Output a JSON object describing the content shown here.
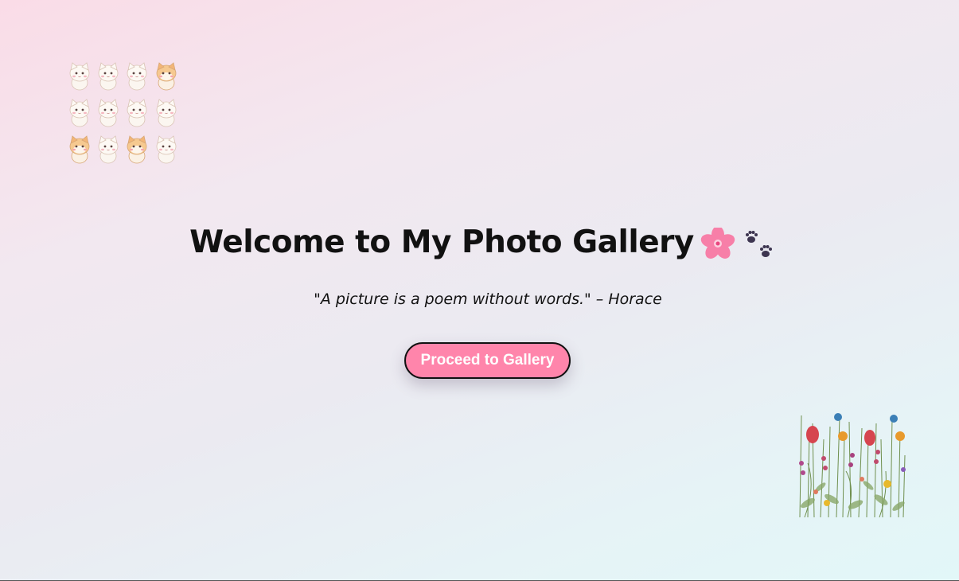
{
  "page": {
    "title": "Welcome to My Photo Gallery",
    "title_icons": [
      "cherry-blossom-icon",
      "paw-prints-icon"
    ],
    "quote": "\"A picture is a poem without words.\" – Horace",
    "button_label": "Proceed to Gallery"
  },
  "decorations": {
    "top_left": "cats-sticker-image",
    "bottom_right": "wildflowers-image"
  },
  "colors": {
    "button_bg": "#ff85ab",
    "button_text": "#ffffff",
    "title_text": "#111111",
    "blossom": "#f77fa8",
    "paw": "#3d3550"
  }
}
